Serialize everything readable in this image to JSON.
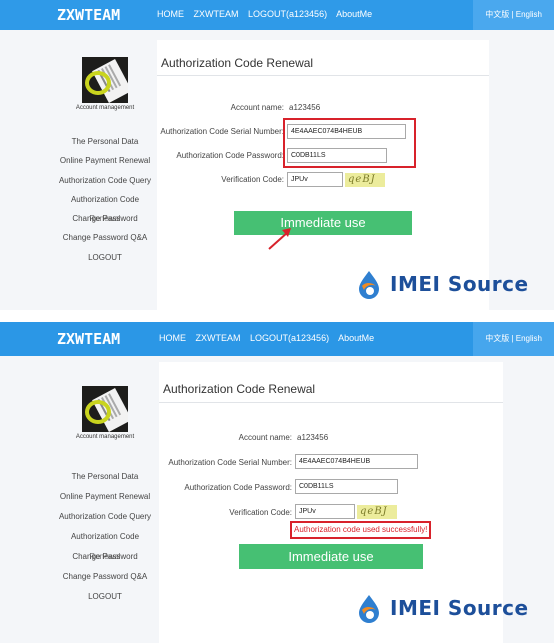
{
  "brand": {
    "logo": "ZXWTEAM"
  },
  "nav": {
    "home": "HOME",
    "zxwteam": "ZXWTEAM",
    "logout": "LOGOUT(a123456)",
    "about": "AboutMe",
    "lang": "中文版 | English"
  },
  "sidebar": {
    "avatar_caption": "Account management",
    "items": [
      "The Personal Data",
      "Online Payment Renewal",
      "Authorization Code Query",
      "Authorization Code",
      "Change Password",
      "Change Password Q&A",
      "LOGOUT"
    ],
    "overlap_text": "Renewal"
  },
  "form": {
    "title": "Authorization Code Renewal",
    "account_label": "Account name:",
    "account_value": "a123456",
    "serial_label": "Authorization Code Serial Number:",
    "serial_value": "4E4AAEC074B4HEUB",
    "password_label": "Authorization Code Password:",
    "password_value": "C0DB11LS",
    "verification_label": "Verification Code:",
    "verification_top": "JPUv",
    "verification_bottom": "JPUv",
    "captcha_text": "qeBJ",
    "button_label": "Immediate use"
  },
  "result": {
    "message": "Authorization code used successfully!"
  },
  "watermark": {
    "text": "IMEI Source"
  },
  "colors": {
    "nav": "#2f9ae8",
    "button": "#46c073",
    "highlight": "#d8222b",
    "watermark": "#1d4f9a"
  }
}
